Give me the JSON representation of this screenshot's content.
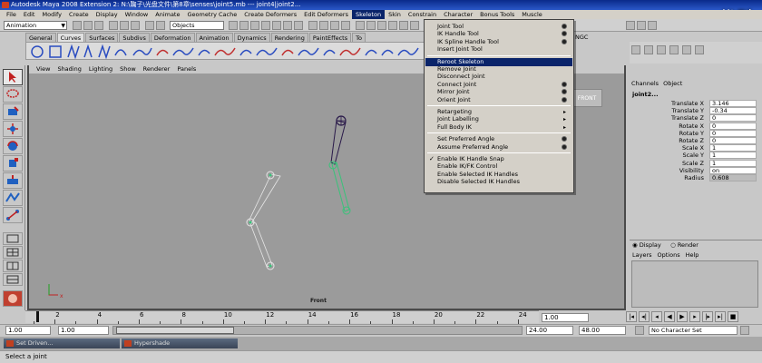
{
  "window": {
    "title": "Autodesk Maya 2008 Extension 2: N:\\鞠子\\光盘文件\\第8章\\senses\\joint5.mb  ---  joint4|joint2...",
    "watermark": "优酷"
  },
  "menubar": {
    "items": [
      "File",
      "Edit",
      "Modify",
      "Create",
      "Display",
      "Window",
      "Animate",
      "Geometry Cache",
      "Create Deformers",
      "Edit Deformers",
      "Skeleton",
      "Skin",
      "Constrain",
      "Character",
      "Bonus Tools",
      "Muscle"
    ],
    "active": "Skeleton"
  },
  "statusline": {
    "mode": "Animation",
    "objects_field": "Objects"
  },
  "shelf": {
    "tabs": [
      "General",
      "Curves",
      "Surfaces",
      "Subdivs",
      "Deformation",
      "Animation",
      "Dynamics",
      "Rendering",
      "PaintEffects",
      "To"
    ],
    "active_tab": "Curves",
    "right_tab": "NGC"
  },
  "viewport": {
    "menu": [
      "View",
      "Shading",
      "Lighting",
      "Show",
      "Renderer",
      "Panels"
    ],
    "camera_label": "Front",
    "viewcube_label": "FRONT",
    "bg_color": "#9b9b9b"
  },
  "skeleton_menu": {
    "items": [
      {
        "label": "Joint Tool",
        "option": true
      },
      {
        "label": "IK Handle Tool",
        "option": true
      },
      {
        "label": "IK Spline Handle Tool",
        "option": true
      },
      {
        "label": "Insert Joint Tool",
        "option": false
      },
      {
        "sep": true
      },
      {
        "label": "Reroot Skeleton",
        "highlighted": true
      },
      {
        "label": "Remove Joint"
      },
      {
        "label": "Disconnect Joint"
      },
      {
        "label": "Connect Joint",
        "option": true
      },
      {
        "label": "Mirror Joint",
        "option": true
      },
      {
        "label": "Orient Joint",
        "option": true
      },
      {
        "sep": true
      },
      {
        "label": "Retargeting",
        "submenu": true
      },
      {
        "label": "Joint Labelling",
        "submenu": true
      },
      {
        "label": "Full Body IK",
        "submenu": true
      },
      {
        "sep": true
      },
      {
        "label": "Set Preferred Angle",
        "option": true
      },
      {
        "label": "Assume Preferred Angle",
        "option": true
      },
      {
        "sep": true
      },
      {
        "label": "Enable IK Handle Snap",
        "checked": true
      },
      {
        "label": "Enable IK/FK Control"
      },
      {
        "label": "Enable Selected IK Handles"
      },
      {
        "label": "Disable Selected IK Handles"
      }
    ]
  },
  "channelbox": {
    "tabs": [
      "Channels",
      "Object"
    ],
    "node": "joint2...",
    "attributes": [
      {
        "label": "Translate X",
        "value": "3.146"
      },
      {
        "label": "Translate Y",
        "value": "-0.34"
      },
      {
        "label": "Translate Z",
        "value": "0"
      },
      {
        "label": "Rotate X",
        "value": "0"
      },
      {
        "label": "Rotate Y",
        "value": "0"
      },
      {
        "label": "Rotate Z",
        "value": "0"
      },
      {
        "label": "Scale X",
        "value": "1"
      },
      {
        "label": "Scale Y",
        "value": "1"
      },
      {
        "label": "Scale Z",
        "value": "1"
      },
      {
        "label": "Visibility",
        "value": "on"
      },
      {
        "label": "Radius",
        "value": "0.608",
        "gray": true
      }
    ]
  },
  "layer_editor": {
    "radio_display": "Display",
    "radio_render": "Render",
    "menu": [
      "Layers",
      "Options",
      "Help"
    ]
  },
  "timeslider": {
    "ticks": [
      "2",
      "4",
      "6",
      "8",
      "10",
      "12",
      "14",
      "16",
      "18",
      "20",
      "22",
      "24"
    ],
    "current_time": "1.00"
  },
  "rangeslider": {
    "start_time": "1.00",
    "range_start": "1.00",
    "range_end": "24.00",
    "end_time": "48.00",
    "character_set": "No Character Set"
  },
  "taskbar": {
    "windows": [
      "Set Driven...",
      "Hypershade"
    ]
  },
  "helpline": {
    "text": "Select a joint"
  },
  "colors": {
    "titlebar": "#0a2a8a",
    "highlight": "#0a246a",
    "joint_white": "#e6e6e6",
    "joint_green": "#3ac27a",
    "joint_dark": "#2a1a4a"
  }
}
